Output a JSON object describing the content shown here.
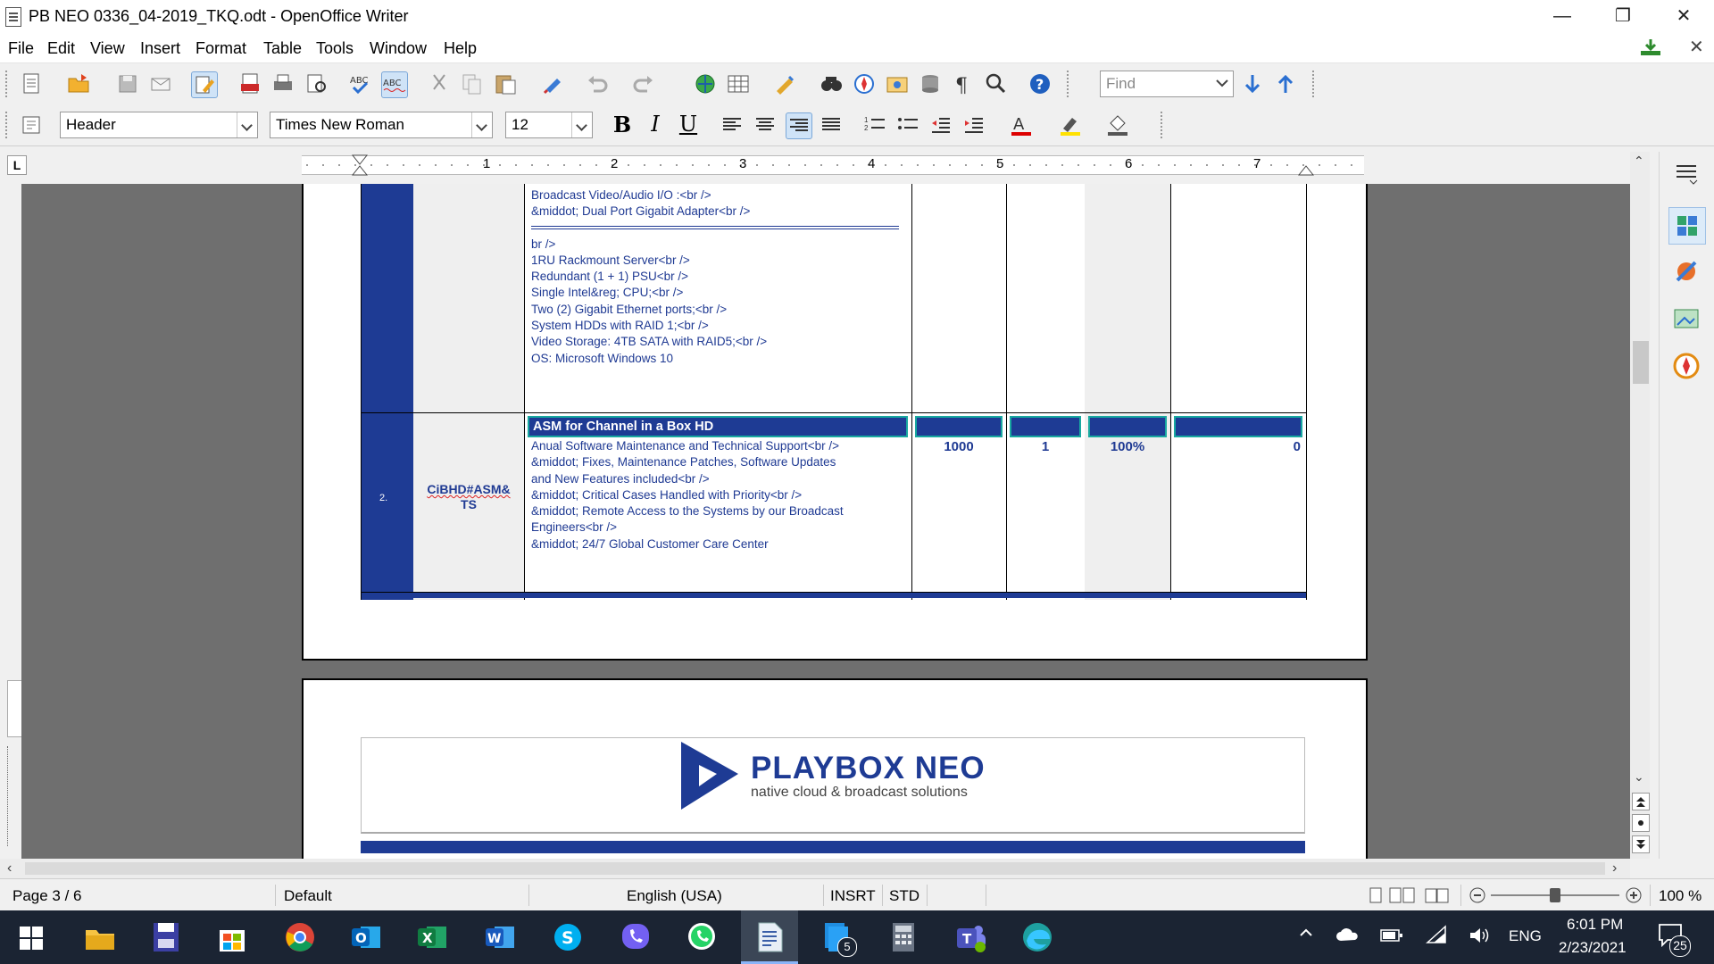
{
  "window": {
    "title": "PB NEO 0336_04-2019_TKQ.odt - OpenOffice Writer",
    "minimize": "—",
    "restore": "❐",
    "close": "✕"
  },
  "menu": [
    "File",
    "Edit",
    "View",
    "Insert",
    "Format",
    "Table",
    "Tools",
    "Window",
    "Help"
  ],
  "toolbar": {
    "find_placeholder": "Find",
    "paragraph_style": "Header",
    "font_name": "Times New Roman",
    "font_size": "12",
    "bold": "B",
    "italic": "I",
    "underline": "U"
  },
  "ruler": {
    "corner": "L",
    "numbers": [
      "1",
      "2",
      "3",
      "4",
      "5",
      "6",
      "7"
    ]
  },
  "document": {
    "row1_lines": [
      "Broadcast Video/Audio I/O :<br />",
      "&middot; Dual Port Gigabit Adapter<br />",
      "br />",
      "1RU Rackmount Server<br />",
      "Redundant (1 + 1) PSU<br />",
      "Single Intel&reg; CPU;<br />",
      "Two (2) Gigabit Ethernet ports;<br />",
      "System HDDs with RAID 1;<br />",
      "Video Storage: 4TB SATA with RAID5;<br />",
      "OS: Microsoft Windows 10"
    ],
    "row2": {
      "number": "2.",
      "code_line1": "CiBHD#ASM&",
      "code_line2": "TS",
      "heading": "ASM for Channel in a Box HD",
      "lines": [
        "Anual Software Maintenance and Technical Support<br />",
        "&middot; Fixes, Maintenance Patches, Software Updates",
        "and New Features included<br />",
        "&middot; Critical Cases Handled with Priority<br />",
        "&middot; Remote Access to the Systems by our Broadcast",
        "Engineers<br />",
        "&middot; 24/7 Global Customer Care Center"
      ],
      "price": "1000",
      "qty": "1",
      "percent": "100%",
      "total": "0"
    },
    "logo_name": "PLAYBOX NEO",
    "logo_tagline": "native cloud & broadcast solutions"
  },
  "status": {
    "page": "Page 3 / 6",
    "style": "Default",
    "language": "English (USA)",
    "insert_mode": "INSRT",
    "selection_mode": "STD",
    "zoom": "100 %"
  },
  "taskbar": {
    "language": "ENG",
    "time": "6:01 PM",
    "date": "2/23/2021",
    "notifications": "25",
    "badge_count": "5"
  },
  "colors": {
    "table_blue": "#1e3b94",
    "teal_border": "#18a8a0",
    "text_blue": "#1f3a93",
    "logo_blue": "#1e3b94"
  }
}
